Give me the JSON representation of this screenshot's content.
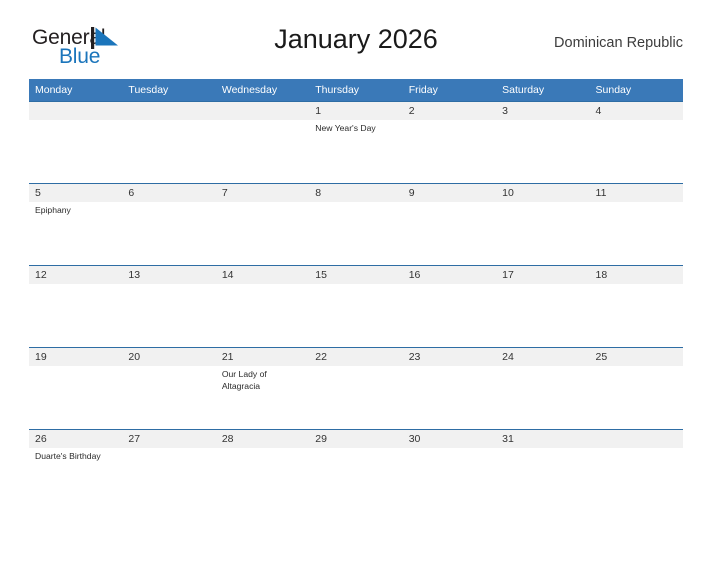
{
  "brand": {
    "name_part1": "General",
    "name_part2": "Blue",
    "flag_icon": "flag-icon",
    "color_dark": "#231f20",
    "color_blue": "#1b75bb"
  },
  "header": {
    "title": "January 2026",
    "country": "Dominican Republic",
    "header_bg": "#3a79b8"
  },
  "calendar": {
    "weekday_headers": [
      "Monday",
      "Tuesday",
      "Wednesday",
      "Thursday",
      "Friday",
      "Saturday",
      "Sunday"
    ],
    "weeks": [
      [
        {
          "day": "",
          "event": ""
        },
        {
          "day": "",
          "event": ""
        },
        {
          "day": "",
          "event": ""
        },
        {
          "day": "1",
          "event": "New Year's Day"
        },
        {
          "day": "2",
          "event": ""
        },
        {
          "day": "3",
          "event": ""
        },
        {
          "day": "4",
          "event": ""
        }
      ],
      [
        {
          "day": "5",
          "event": "Epiphany"
        },
        {
          "day": "6",
          "event": ""
        },
        {
          "day": "7",
          "event": ""
        },
        {
          "day": "8",
          "event": ""
        },
        {
          "day": "9",
          "event": ""
        },
        {
          "day": "10",
          "event": ""
        },
        {
          "day": "11",
          "event": ""
        }
      ],
      [
        {
          "day": "12",
          "event": ""
        },
        {
          "day": "13",
          "event": ""
        },
        {
          "day": "14",
          "event": ""
        },
        {
          "day": "15",
          "event": ""
        },
        {
          "day": "16",
          "event": ""
        },
        {
          "day": "17",
          "event": ""
        },
        {
          "day": "18",
          "event": ""
        }
      ],
      [
        {
          "day": "19",
          "event": ""
        },
        {
          "day": "20",
          "event": ""
        },
        {
          "day": "21",
          "event": "Our Lady of Altagracia"
        },
        {
          "day": "22",
          "event": ""
        },
        {
          "day": "23",
          "event": ""
        },
        {
          "day": "24",
          "event": ""
        },
        {
          "day": "25",
          "event": ""
        }
      ],
      [
        {
          "day": "26",
          "event": "Duarte's Birthday"
        },
        {
          "day": "27",
          "event": ""
        },
        {
          "day": "28",
          "event": ""
        },
        {
          "day": "29",
          "event": ""
        },
        {
          "day": "30",
          "event": ""
        },
        {
          "day": "31",
          "event": ""
        },
        {
          "day": "",
          "event": ""
        }
      ]
    ]
  }
}
